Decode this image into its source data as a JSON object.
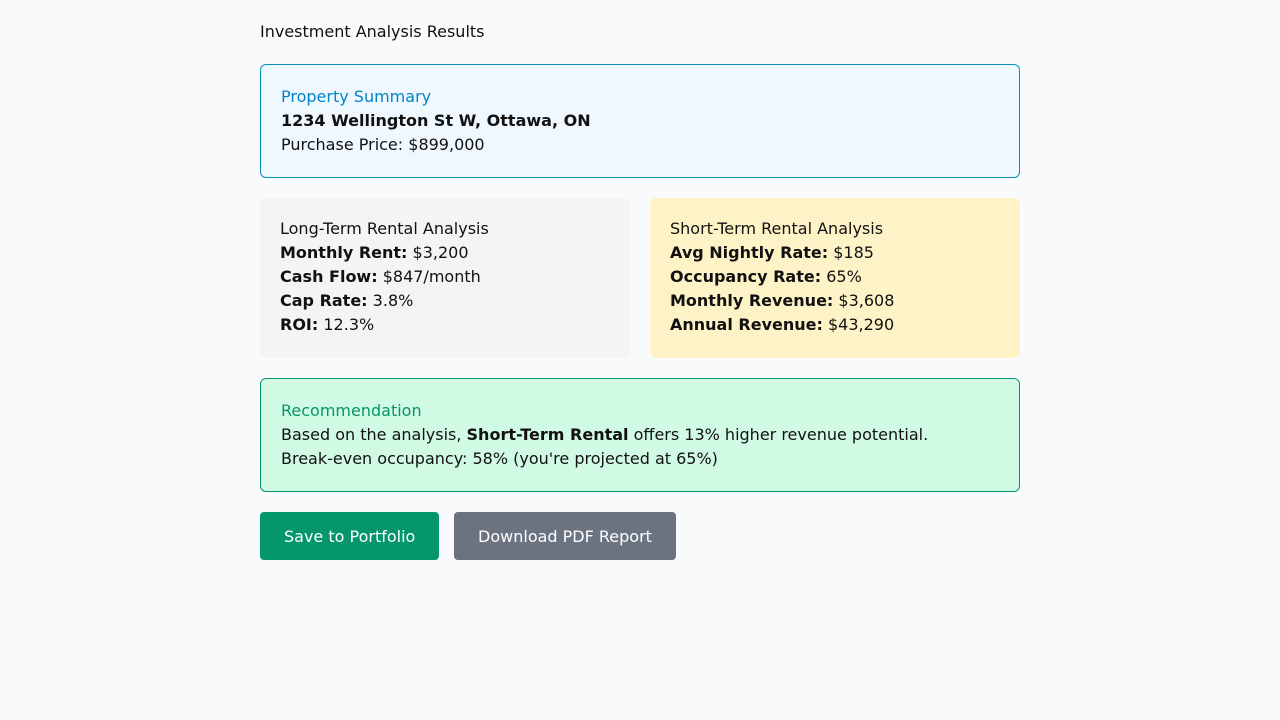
{
  "page": {
    "title": "Investment Analysis Results"
  },
  "summary": {
    "heading": "Property Summary",
    "address": "1234 Wellington St W, Ottawa, ON",
    "price_label": "Purchase Price:",
    "price_value": "$899,000"
  },
  "long_term": {
    "heading": "Long-Term Rental Analysis",
    "rows": [
      {
        "label": "Monthly Rent:",
        "value": "$3,200"
      },
      {
        "label": "Cash Flow:",
        "value": "$847/month"
      },
      {
        "label": "Cap Rate:",
        "value": "3.8%"
      },
      {
        "label": "ROI:",
        "value": "12.3%"
      }
    ]
  },
  "short_term": {
    "heading": "Short-Term Rental Analysis",
    "rows": [
      {
        "label": "Avg Nightly Rate:",
        "value": "$185"
      },
      {
        "label": "Occupancy Rate:",
        "value": "65%"
      },
      {
        "label": "Monthly Revenue:",
        "value": "$3,608"
      },
      {
        "label": "Annual Revenue:",
        "value": "$43,290"
      }
    ]
  },
  "recommendation": {
    "heading": "Recommendation",
    "text_before": "Based on the analysis,",
    "text_bold": "Short-Term Rental",
    "text_after": "offers 13% higher revenue potential.",
    "break_even": "Break-even occupancy: 58% (you're projected at 65%)"
  },
  "actions": {
    "save_label": "Save to Portfolio",
    "download_label": "Download PDF Report"
  },
  "colors": {
    "background": "#f8fafc",
    "summary_bg": "#eff8fe",
    "summary_border": "#0891b2",
    "long_term_bg": "#f4f4f5",
    "short_term_bg": "#fef3c7",
    "recommendation_bg": "#d1fae5",
    "recommendation_border": "#059669",
    "save_button": "#059669",
    "download_button": "#6b7280"
  }
}
